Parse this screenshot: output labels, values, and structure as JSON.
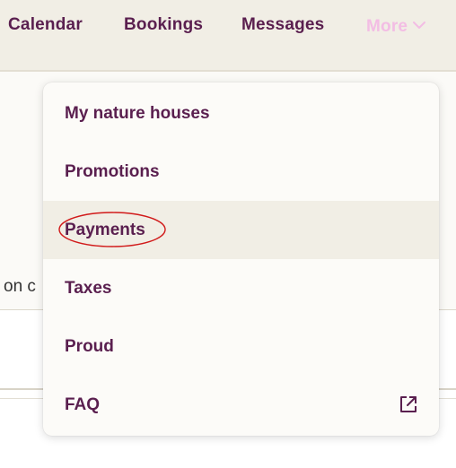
{
  "nav": {
    "items": [
      {
        "label": "Calendar"
      },
      {
        "label": "Bookings"
      },
      {
        "label": "Messages"
      }
    ],
    "more": {
      "label": "More",
      "icon": "chevron-down-icon"
    }
  },
  "background": {
    "text_fragment": "on c"
  },
  "menu": {
    "items": [
      {
        "label": "My nature houses"
      },
      {
        "label": "Promotions"
      },
      {
        "label": "Payments",
        "highlighted": true
      },
      {
        "label": "Taxes"
      },
      {
        "label": "Proud"
      },
      {
        "label": "FAQ",
        "icon": "external-link-icon"
      }
    ]
  },
  "colors": {
    "brand": "#5a1f4f",
    "more_inactive": "#f3bde4",
    "topbar_bg": "#f1eee5",
    "annotation": "#d11a1a"
  }
}
